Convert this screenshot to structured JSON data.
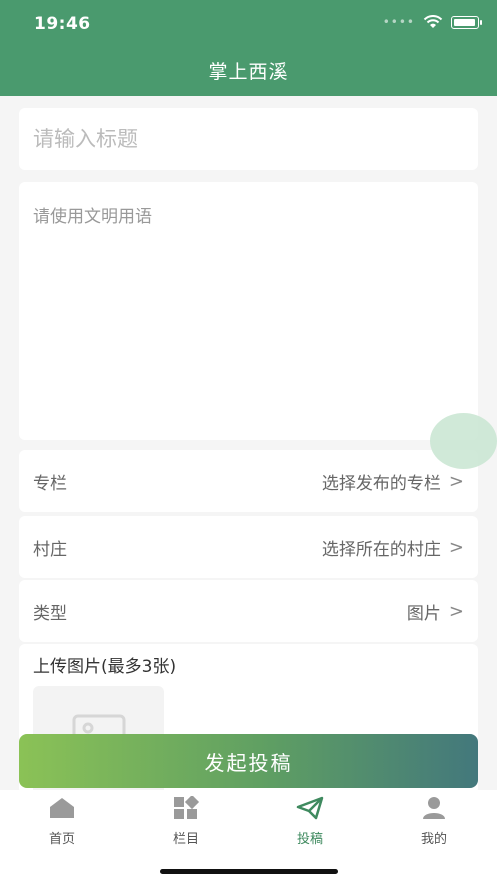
{
  "status": {
    "time": "19:46"
  },
  "header": {
    "title": "掌上西溪"
  },
  "form": {
    "title_placeholder": "请输入标题",
    "content_placeholder": "请使用文明用语",
    "column": {
      "label": "专栏",
      "value": "选择发布的专栏"
    },
    "village": {
      "label": "村庄",
      "value": "选择所在的村庄"
    },
    "type": {
      "label": "类型",
      "value": "图片"
    },
    "upload": {
      "title": "上传图片(最多3张)"
    },
    "submit_label": "发起投稿"
  },
  "tabbar": {
    "items": [
      {
        "label": "首页",
        "icon": "home-icon"
      },
      {
        "label": "栏目",
        "icon": "grid-icon"
      },
      {
        "label": "投稿",
        "icon": "send-icon",
        "active": true
      },
      {
        "label": "我的",
        "icon": "user-icon"
      }
    ]
  },
  "colors": {
    "brand": "#4a9a6e",
    "active_tab": "#3f8a5f"
  }
}
